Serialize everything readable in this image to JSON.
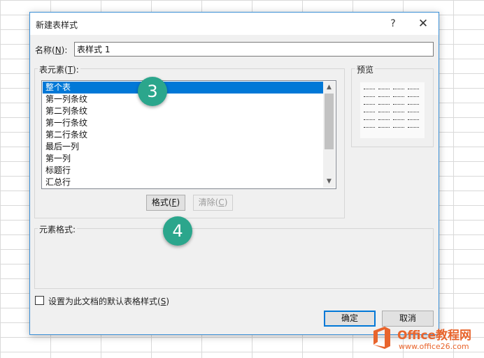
{
  "dialog": {
    "title": "新建表样式",
    "help_label": "?",
    "close_label": "✕"
  },
  "name_field": {
    "label_prefix": "名称(",
    "label_key": "N",
    "label_suffix": "):",
    "value": "表样式 1"
  },
  "table_elements": {
    "label_prefix": "表元素(",
    "label_key": "T",
    "label_suffix": "):",
    "items": [
      "整个表",
      "第一列条纹",
      "第二列条纹",
      "第一行条纹",
      "第二行条纹",
      "最后一列",
      "第一列",
      "标题行",
      "汇总行"
    ],
    "selected_index": 0
  },
  "buttons": {
    "format_prefix": "格式(",
    "format_key": "F",
    "format_suffix": ")",
    "clear_prefix": "清除(",
    "clear_key": "C",
    "clear_suffix": ")",
    "ok_label": "确定",
    "cancel_label": "取消"
  },
  "preview": {
    "label": "预览"
  },
  "element_format": {
    "label": "元素格式:"
  },
  "default_checkbox": {
    "label_prefix": "设置为此文档的默认表格样式(",
    "label_key": "S",
    "label_suffix": ")",
    "checked": false
  },
  "annotations": {
    "step3": "3",
    "step4": "4"
  },
  "watermark": {
    "name": "Office教程网",
    "url": "www.office26.com"
  },
  "colors": {
    "selection": "#0078d7",
    "badge": "#2ba68c",
    "watermark": "#e8642c",
    "dialog_border": "#3a8fd6"
  }
}
